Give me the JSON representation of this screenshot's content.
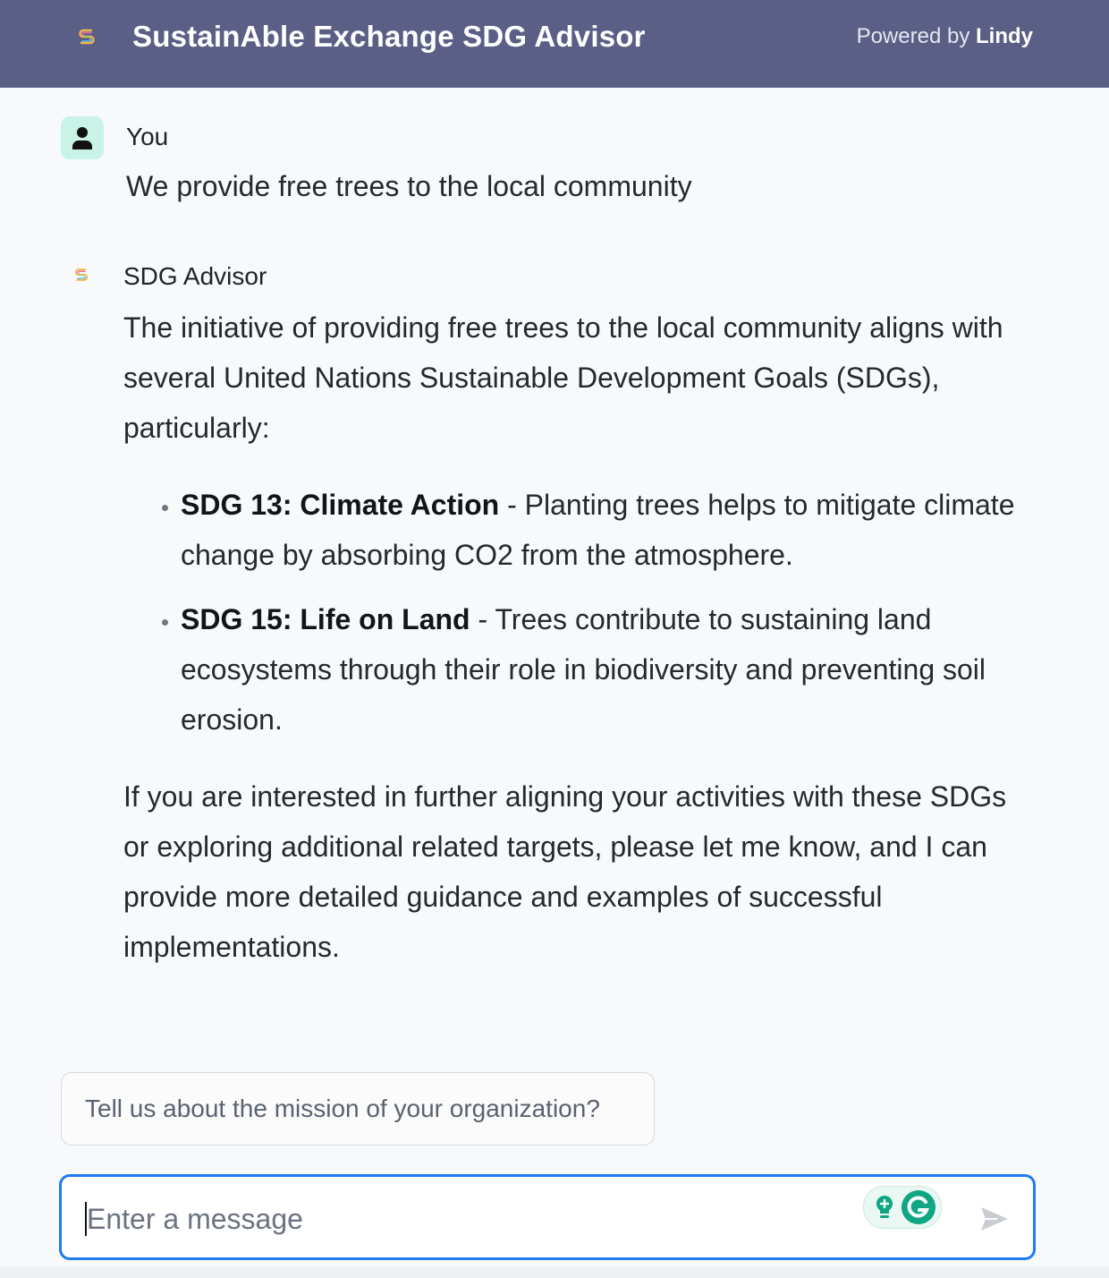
{
  "header": {
    "title": "SustainAble Exchange SDG Advisor",
    "powered_prefix": "Powered by",
    "powered_brand": "Lindy"
  },
  "user_message": {
    "author": "You",
    "text": "We provide free trees to the local community"
  },
  "bot_message": {
    "author": "SDG Advisor",
    "intro": "The initiative of providing free trees to the local community aligns with several United Nations Sustainable Development Goals (SDGs), particularly:",
    "items": [
      {
        "title": "SDG 13: Climate Action",
        "text": " - Planting trees helps to mitigate climate change by absorbing CO2 from the atmosphere."
      },
      {
        "title": "SDG 15: Life on Land",
        "text": " - Trees contribute to sustaining land ecosystems through their role in biodiversity and preventing soil erosion."
      }
    ],
    "outro": "If you are interested in further aligning your activities with these SDGs or exploring additional related targets, please let me know, and I can provide more detailed guidance and examples of successful implementations."
  },
  "suggestion": {
    "text": "Tell us about the mission of your organization?"
  },
  "composer": {
    "placeholder": "Enter a message"
  },
  "colors": {
    "header_bg": "#5b5f86",
    "input_border": "#1f7bf2",
    "avatar_bg": "#c8f3e6",
    "grammarly": "#11a683"
  },
  "icons": {
    "logo": "rainbow-s-logo-icon",
    "user": "person-icon",
    "send": "send-arrow-icon",
    "grammarly": "grammarly-icon",
    "bulb": "lightbulb-icon"
  }
}
